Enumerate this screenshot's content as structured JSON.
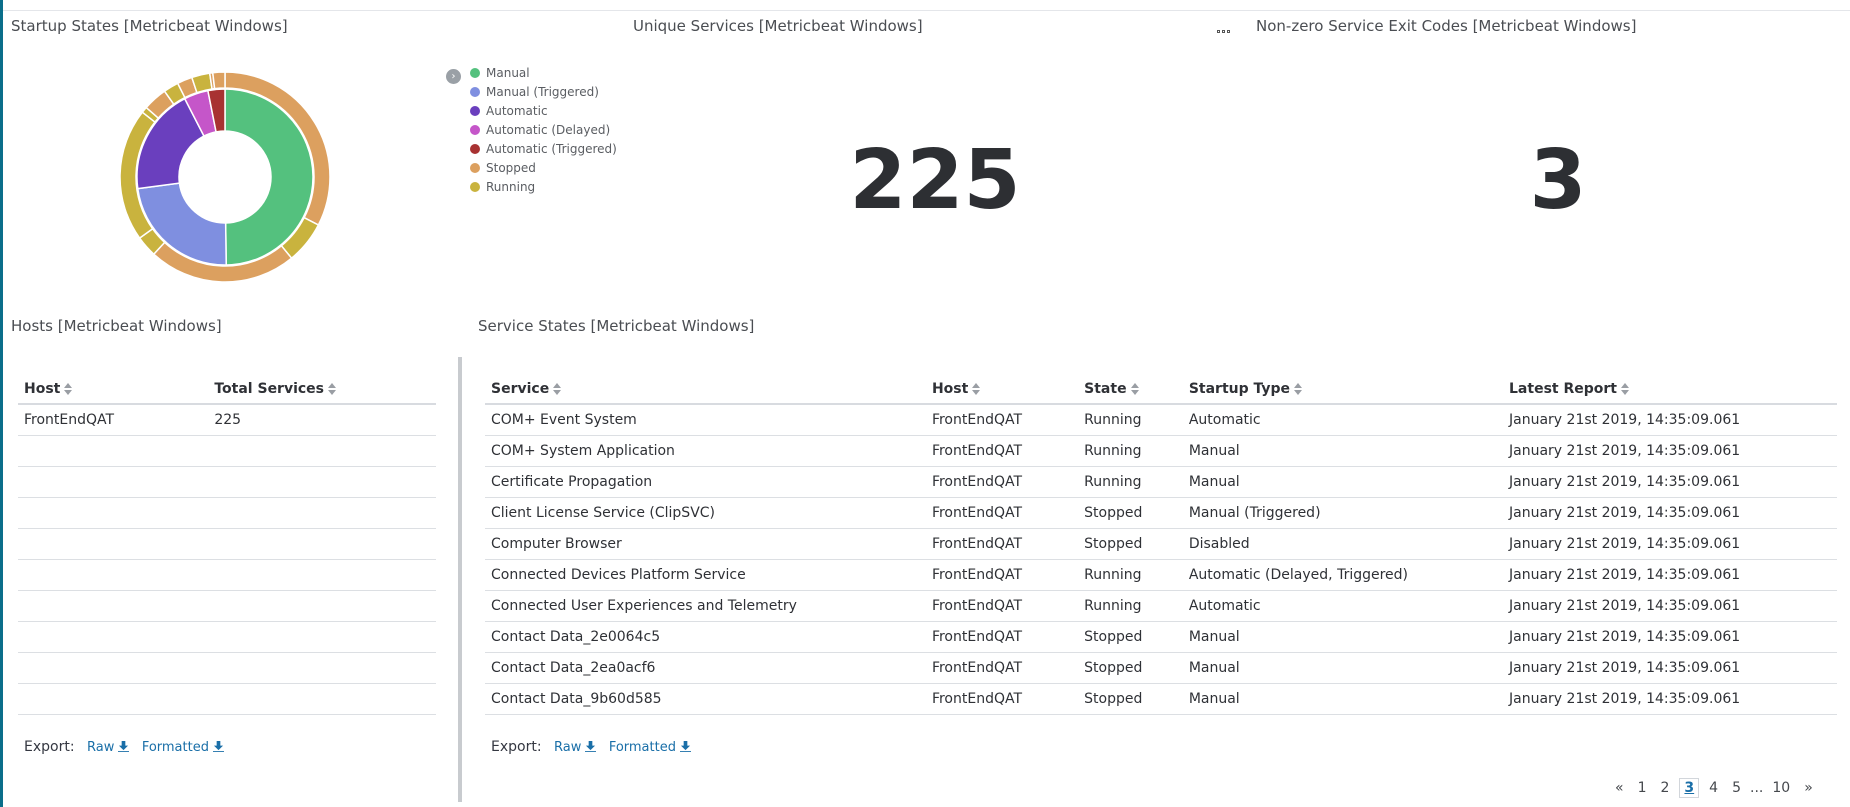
{
  "panels": {
    "startup_states": {
      "title": "Startup States [Metricbeat Windows]"
    },
    "unique_services": {
      "title": "Unique Services [Metricbeat Windows]",
      "value": "225"
    },
    "exit_codes": {
      "title": "Non-zero Service Exit Codes [Metricbeat Windows]",
      "value": "3"
    },
    "hosts": {
      "title": "Hosts [Metricbeat Windows]"
    },
    "service_states": {
      "title": "Service States [Metricbeat Windows]"
    }
  },
  "legend": {
    "toggle_icon": "chevron-right-icon",
    "items": [
      {
        "label": "Manual",
        "color": "#54c17e"
      },
      {
        "label": "Manual (Triggered)",
        "color": "#7f8fe0"
      },
      {
        "label": "Automatic",
        "color": "#6a3fbe"
      },
      {
        "label": "Automatic (Delayed)",
        "color": "#c556c9"
      },
      {
        "label": "Automatic (Triggered)",
        "color": "#a83232"
      },
      {
        "label": "Stopped",
        "color": "#dca05f"
      },
      {
        "label": "Running",
        "color": "#c9b33e"
      }
    ]
  },
  "chart_data": {
    "type": "pie",
    "rings": [
      {
        "name": "Startup Type",
        "slices": [
          {
            "label": "Manual",
            "value": 112,
            "color": "#54c17e"
          },
          {
            "label": "Manual (Triggered)",
            "value": 52,
            "color": "#7f8fe0"
          },
          {
            "label": "Automatic",
            "value": 44,
            "color": "#6a3fbe"
          },
          {
            "label": "Automatic (Delayed)",
            "value": 10,
            "color": "#c556c9"
          },
          {
            "label": "Automatic (Triggered)",
            "value": 7,
            "color": "#a83232"
          }
        ]
      },
      {
        "name": "State",
        "slices": [
          {
            "label": "Stopped",
            "value": 70,
            "color": "#dca05f"
          },
          {
            "label": "Running",
            "value": 14,
            "color": "#c9b33e"
          },
          {
            "label": "Stopped",
            "value": 49,
            "color": "#dca05f"
          },
          {
            "label": "Running",
            "value": 7,
            "color": "#c9b33e"
          },
          {
            "label": "Running",
            "value": 44,
            "color": "#c9b33e"
          },
          {
            "label": "Running",
            "value": 2,
            "color": "#c9b33e"
          },
          {
            "label": "Stopped",
            "value": 8,
            "color": "#dca05f"
          },
          {
            "label": "Running",
            "value": 5,
            "color": "#c9b33e"
          },
          {
            "label": "Stopped",
            "value": 5,
            "color": "#dca05f"
          },
          {
            "label": "Running",
            "value": 6,
            "color": "#c9b33e"
          },
          {
            "label": "Stopped",
            "value": 1,
            "color": "#dca05f"
          },
          {
            "label": "Stopped",
            "value": 4,
            "color": "#dca05f"
          }
        ]
      }
    ]
  },
  "hosts_table": {
    "columns": [
      "Host",
      "Total Services"
    ],
    "rows": [
      [
        "FrontEndQAT",
        "225"
      ],
      [
        "",
        ""
      ],
      [
        "",
        ""
      ],
      [
        "",
        ""
      ],
      [
        "",
        ""
      ],
      [
        "",
        ""
      ],
      [
        "",
        ""
      ],
      [
        "",
        ""
      ],
      [
        "",
        ""
      ],
      [
        "",
        ""
      ]
    ]
  },
  "services_table": {
    "columns": [
      "Service",
      "Host",
      "State",
      "Startup Type",
      "Latest Report"
    ],
    "rows": [
      [
        "COM+ Event System",
        "FrontEndQAT",
        "Running",
        "Automatic",
        "January 21st 2019, 14:35:09.061"
      ],
      [
        "COM+ System Application",
        "FrontEndQAT",
        "Running",
        "Manual",
        "January 21st 2019, 14:35:09.061"
      ],
      [
        "Certificate Propagation",
        "FrontEndQAT",
        "Running",
        "Manual",
        "January 21st 2019, 14:35:09.061"
      ],
      [
        "Client License Service (ClipSVC)",
        "FrontEndQAT",
        "Stopped",
        "Manual (Triggered)",
        "January 21st 2019, 14:35:09.061"
      ],
      [
        "Computer Browser",
        "FrontEndQAT",
        "Stopped",
        "Disabled",
        "January 21st 2019, 14:35:09.061"
      ],
      [
        "Connected Devices Platform Service",
        "FrontEndQAT",
        "Running",
        "Automatic (Delayed, Triggered)",
        "January 21st 2019, 14:35:09.061"
      ],
      [
        "Connected User Experiences and Telemetry",
        "FrontEndQAT",
        "Running",
        "Automatic",
        "January 21st 2019, 14:35:09.061"
      ],
      [
        "Contact Data_2e0064c5",
        "FrontEndQAT",
        "Stopped",
        "Manual",
        "January 21st 2019, 14:35:09.061"
      ],
      [
        "Contact Data_2ea0acf6",
        "FrontEndQAT",
        "Stopped",
        "Manual",
        "January 21st 2019, 14:35:09.061"
      ],
      [
        "Contact Data_9b60d585",
        "FrontEndQAT",
        "Stopped",
        "Manual",
        "January 21st 2019, 14:35:09.061"
      ]
    ]
  },
  "export": {
    "label": "Export:",
    "raw": "Raw",
    "formatted": "Formatted",
    "icon": "download-icon"
  },
  "pagination": {
    "prev": "«",
    "pages": [
      "1",
      "2",
      "3",
      "4",
      "5"
    ],
    "current": "3",
    "ellipsis": "...",
    "last": "10",
    "next": "»"
  },
  "toolbar": {
    "options_icon": "options-icon"
  }
}
